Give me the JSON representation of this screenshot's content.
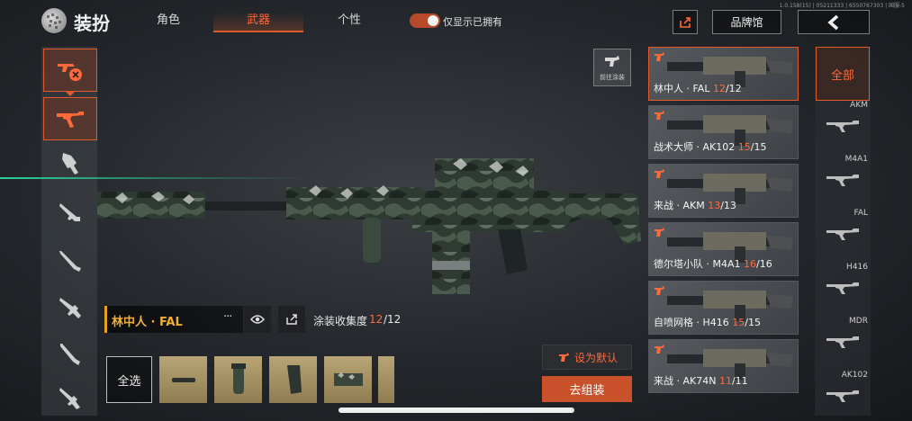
{
  "version": "1.0.158(15) | 05211333 | 6550767303 | 国服-5",
  "header": {
    "title": "装扮",
    "tabs": [
      {
        "label": "角色",
        "active": false
      },
      {
        "label": "武器",
        "active": true
      },
      {
        "label": "个性",
        "active": false
      }
    ],
    "toggle_label": "仅显示已拥有",
    "toggle_on": true,
    "brand_label": "品牌馆"
  },
  "paint": {
    "label": "前往涂装"
  },
  "skin": {
    "name": "林中人 · FAL",
    "dots": "···",
    "collection_label": "涂装收集度",
    "collection_owned": "12",
    "collection_total": "/12"
  },
  "parts": {
    "select_all": "全选"
  },
  "actions": {
    "set_default": "设为默认",
    "assemble": "去组装"
  },
  "cards": [
    {
      "name": "林中人 · FAL ",
      "owned": "12",
      "total": "/12",
      "selected": true
    },
    {
      "name": "战术大师 · AK102 ",
      "owned": "15",
      "total": "/15",
      "selected": false
    },
    {
      "name": "来战 · AKM ",
      "owned": "13",
      "total": "/13",
      "selected": false
    },
    {
      "name": "德尔塔小队 · M4A1 ",
      "owned": "16",
      "total": "/16",
      "selected": false
    },
    {
      "name": "自喷网格 · H416 ",
      "owned": "15",
      "total": "/15",
      "selected": false
    },
    {
      "name": "来战 · AK74N ",
      "owned": "11",
      "total": "/11",
      "selected": false
    }
  ],
  "filter": {
    "all_label": "全部",
    "items": [
      "AKM",
      "M4A1",
      "FAL",
      "H416",
      "MDR",
      "AK102"
    ]
  },
  "colors": {
    "accent": "#e25a2a",
    "gold": "#e7a21a",
    "laser": "#28dca0"
  }
}
